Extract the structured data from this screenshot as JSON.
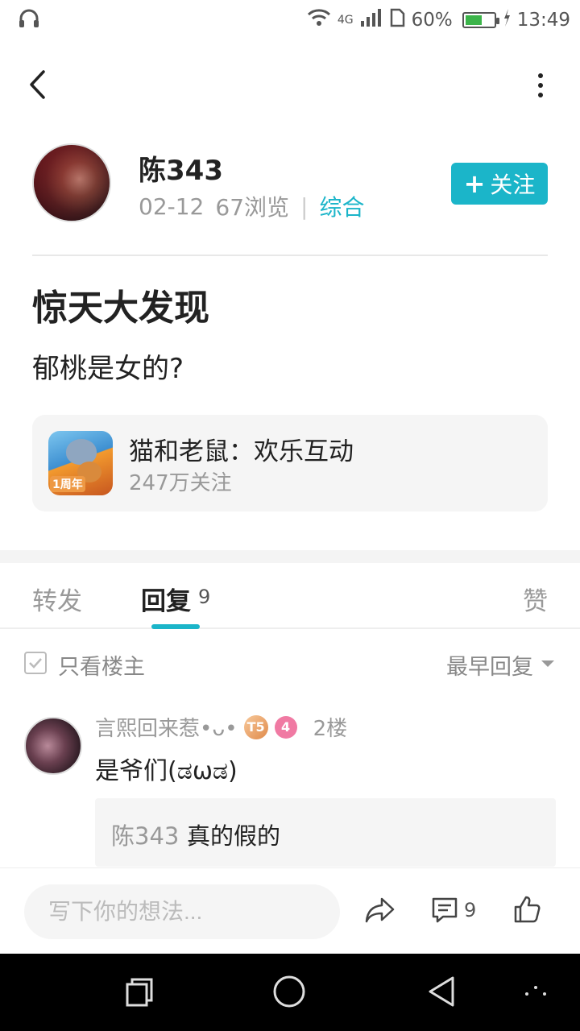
{
  "status_bar": {
    "network": "4G",
    "battery": "60%",
    "battery_level": 0.6,
    "time": "13:49"
  },
  "author": {
    "name": "陈343",
    "date": "02-12",
    "views": "67浏览",
    "category": "综合",
    "follow_label": "关注"
  },
  "post": {
    "title": "惊天大发现",
    "body": "郁桃是女的?"
  },
  "game_card": {
    "name": "猫和老鼠：欢乐互动",
    "followers": "247万关注",
    "icon_badge": "1周年"
  },
  "tabs": {
    "repost": "转发",
    "reply": "回复",
    "reply_count": "9",
    "like": "赞"
  },
  "filter": {
    "only_op": "只看楼主",
    "sort": "最早回复"
  },
  "comment": {
    "user": "言熙回来惹•ᴗ•",
    "level_badge": "T5",
    "pink_badge": "4",
    "floor": "2楼",
    "text": "是爷们(ಡωಡ)",
    "quote_author": "陈343 :",
    "quote_text": "真的假的"
  },
  "bottom_bar": {
    "input_placeholder": "写下你的想法...",
    "comment_count": "9"
  },
  "colors": {
    "accent": "#1bb5c9",
    "text_primary": "#222222",
    "text_secondary": "#999999"
  }
}
